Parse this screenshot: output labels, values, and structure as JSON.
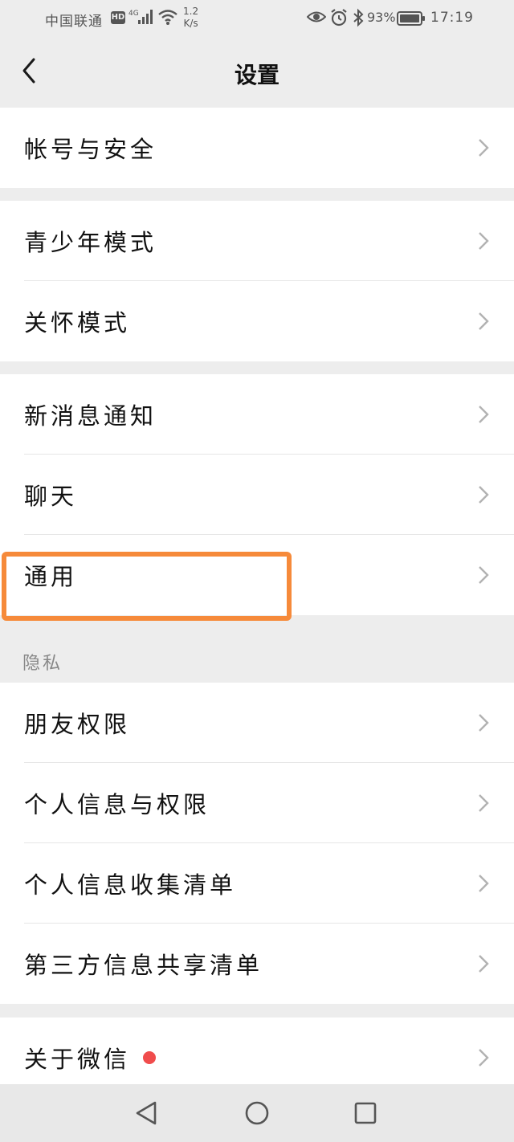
{
  "status_bar": {
    "carrier": "中国联通",
    "hd": "HD",
    "network": "4G",
    "speed_value": "1.2",
    "speed_unit": "K/s",
    "battery": "93%",
    "time": "17:19"
  },
  "header": {
    "title": "设置"
  },
  "groups": {
    "account": [
      "帐号与安全"
    ],
    "modes": [
      "青少年模式",
      "关怀模式"
    ],
    "general": [
      "新消息通知",
      "聊天",
      "通用"
    ],
    "privacy_title": "隐私",
    "privacy": [
      "朋友权限",
      "个人信息与权限",
      "个人信息收集清单",
      "第三方信息共享清单"
    ],
    "about": [
      "关于微信"
    ]
  },
  "colors": {
    "highlight": "#f68a3a",
    "badge": "#f04c4c",
    "background": "#ededed"
  }
}
